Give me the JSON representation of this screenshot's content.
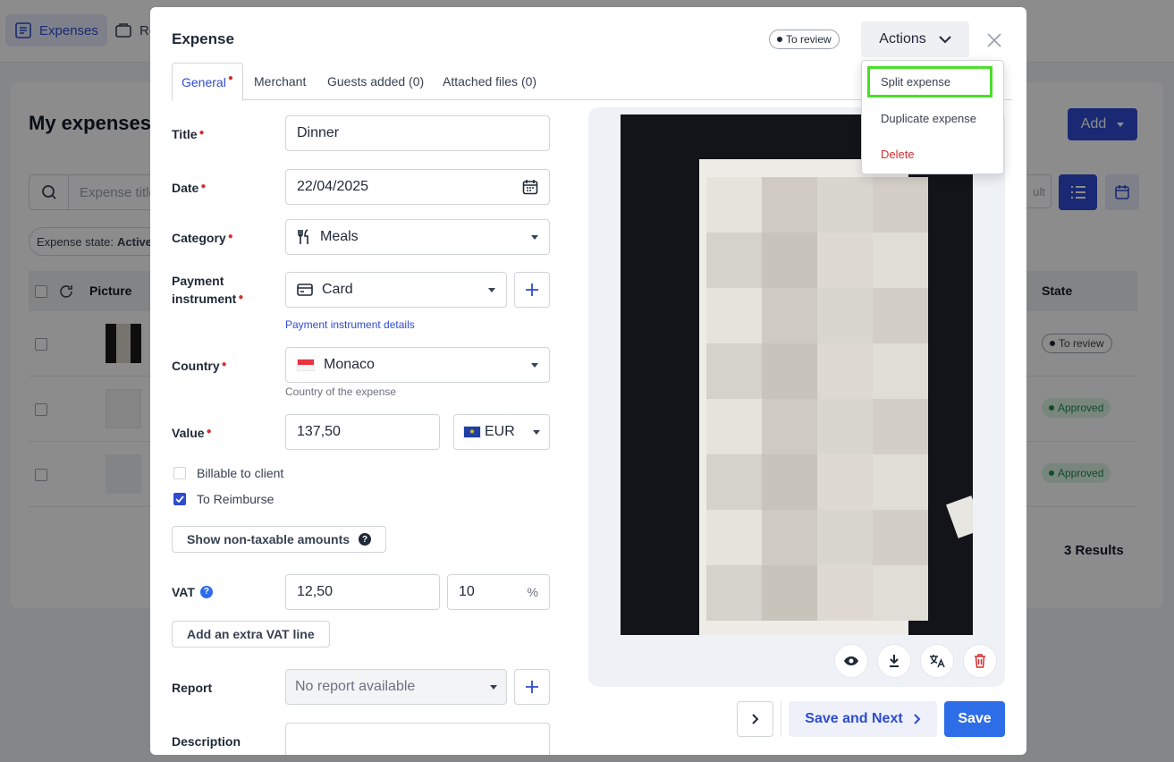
{
  "background": {
    "nav": {
      "expenses_label": "Expenses",
      "reports_label": "Re"
    },
    "page_title": "My expenses",
    "search_placeholder": "Expense title",
    "filter": {
      "label": "Expense state:",
      "value": "Active"
    },
    "add_label": "Add",
    "ghost_label": "ult",
    "table": {
      "col_picture": "Picture",
      "col_state": "State"
    },
    "rows": [
      {
        "state": "To review"
      },
      {
        "state": "Approved"
      },
      {
        "state": "Approved"
      }
    ],
    "results": "3 Results"
  },
  "modal": {
    "title": "Expense",
    "status": "To review",
    "actions_label": "Actions",
    "tabs": [
      "General",
      "Merchant",
      "Guests added (0)",
      "Attached files (0)"
    ],
    "form": {
      "title_label": "Title",
      "title_value": "Dinner",
      "date_label": "Date",
      "date_value": "22/04/2025",
      "category_label": "Category",
      "category_value": "Meals",
      "payment_label_1": "Payment",
      "payment_label_2": "instrument",
      "payment_value": "Card",
      "payment_link": "Payment instrument details",
      "country_label": "Country",
      "country_value": "Monaco",
      "country_helper": "Country of the expense",
      "value_label": "Value",
      "value_amount": "137,50",
      "currency": "EUR",
      "billable_label": "Billable to client",
      "billable_checked": false,
      "reimburse_label": "To Reimburse",
      "reimburse_checked": true,
      "non_taxable_label": "Show non-taxable amounts",
      "vat_label": "VAT",
      "vat_amount": "12,50",
      "vat_rate": "10",
      "vat_unit": "%",
      "extra_vat_label": "Add an extra VAT line",
      "report_label": "Report",
      "report_value": "No report available",
      "description_label": "Description",
      "description_value": ""
    },
    "footer": {
      "save_next_label": "Save and Next",
      "save_label": "Save"
    }
  },
  "dropdown": {
    "items": [
      "Split expense",
      "Duplicate expense",
      "Delete"
    ]
  },
  "colors": {
    "primary": "#2e4bd1",
    "save": "#2e6de8",
    "danger": "#d32f2f",
    "highlight": "#4ade28",
    "approved": "#1f8a4c"
  }
}
